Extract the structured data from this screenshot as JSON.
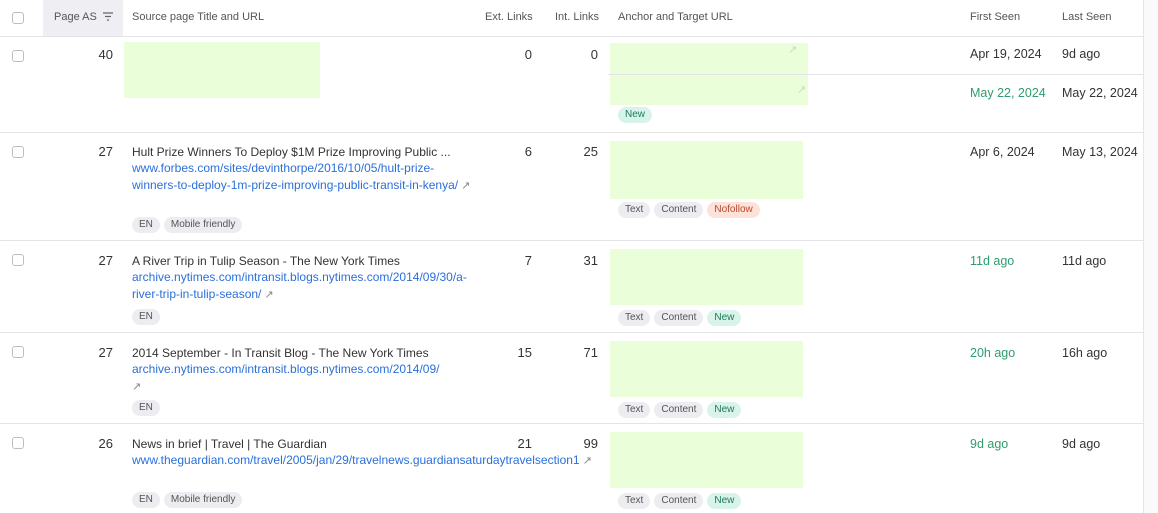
{
  "header": {
    "page_as": "Page AS",
    "source": "Source page Title and URL",
    "ext_links": "Ext. Links",
    "int_links": "Int. Links",
    "anchor": "Anchor and Target URL",
    "first_seen": "First Seen",
    "last_seen": "Last Seen",
    "sort_icon": "sort-descending-icon"
  },
  "rows": [
    {
      "page_as": "40",
      "ext_links": "0",
      "int_links": "0",
      "first_seen": "Apr 19, 2024",
      "last_seen": "9d ago",
      "first_seen2": "May 22, 2024",
      "last_seen2": "May 22, 2024",
      "anchor_tag": "New"
    },
    {
      "page_as": "27",
      "ext_links": "6",
      "int_links": "25",
      "title": "Hult Prize Winners To Deploy $1M Prize Improving Public ...",
      "url": "www.forbes.com/sites/devinthorpe/2016/10/05/hult-prize-winners-to-deploy-1m-prize-improving-public-transit-in-kenya/",
      "tag1": "EN",
      "tag2": "Mobile friendly",
      "anchor_tags": [
        "Text",
        "Content",
        "Nofollow"
      ],
      "first_seen": "Apr 6, 2024",
      "last_seen": "May 13, 2024"
    },
    {
      "page_as": "27",
      "ext_links": "7",
      "int_links": "31",
      "title": "A River Trip in Tulip Season - The New York Times",
      "url": "archive.nytimes.com/intransit.blogs.nytimes.com/2014/09/30/a-river-trip-in-tulip-season/",
      "tag1": "EN",
      "anchor_tags": [
        "Text",
        "Content",
        "New"
      ],
      "first_seen": "11d ago",
      "last_seen": "11d ago"
    },
    {
      "page_as": "27",
      "ext_links": "15",
      "int_links": "71",
      "title": "2014 September - In Transit Blog - The New York Times",
      "url": "archive.nytimes.com/intransit.blogs.nytimes.com/2014/09/",
      "tag1": "EN",
      "anchor_tags": [
        "Text",
        "Content",
        "New"
      ],
      "first_seen": "20h ago",
      "last_seen": "16h ago"
    },
    {
      "page_as": "26",
      "ext_links": "21",
      "int_links": "99",
      "title": "News in brief | Travel | The Guardian",
      "url": "www.theguardian.com/travel/2005/jan/29/travelnews.guardiansaturdaytravelsection1",
      "tag1": "EN",
      "tag2": "Mobile friendly",
      "anchor_tags": [
        "Text",
        "Content",
        "New"
      ],
      "first_seen": "9d ago",
      "last_seen": "9d ago"
    }
  ],
  "colors": {
    "link": "#2a6fdb",
    "new_green": "#2f9c6e",
    "redacted": "#eaffd9"
  }
}
